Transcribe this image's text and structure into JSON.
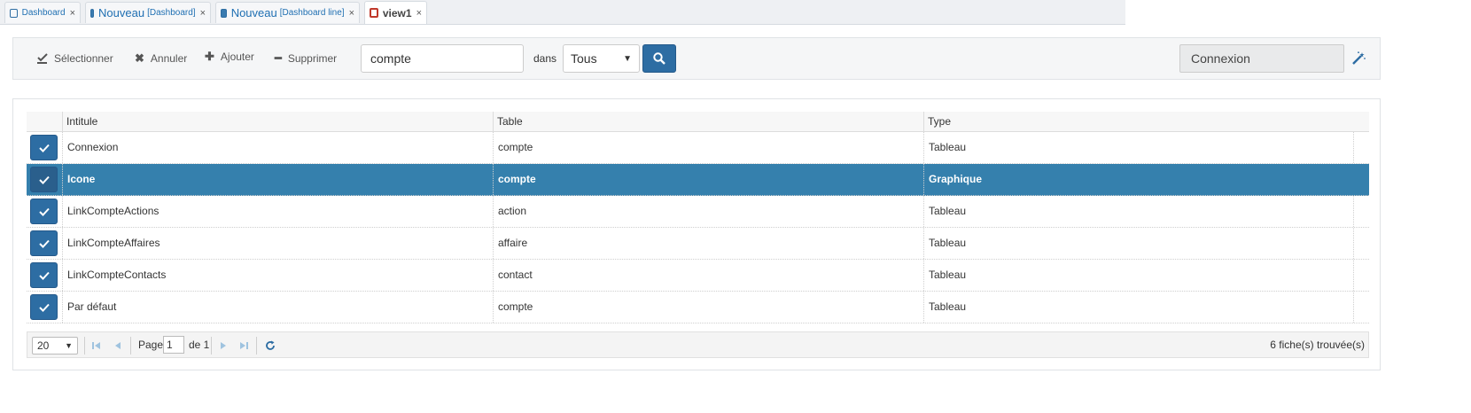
{
  "tabs": [
    {
      "label": "Dashboard",
      "sub": "",
      "close": "×"
    },
    {
      "label": "Nouveau",
      "sub": "[Dashboard]",
      "close": "×"
    },
    {
      "label": "Nouveau",
      "sub": "[Dashboard line]",
      "close": "×"
    },
    {
      "label": "view1",
      "sub": "",
      "close": "×"
    }
  ],
  "toolbar": {
    "select_label": "Sélectionner",
    "cancel_label": "Annuler",
    "add_label": "Ajouter",
    "delete_label": "Supprimer",
    "search_value": "compte",
    "in_label": "dans",
    "scope_value": "Tous",
    "view_value": "Connexion"
  },
  "grid": {
    "columns": [
      "Intitule",
      "Table",
      "Type"
    ],
    "rows": [
      {
        "intitule": "Connexion",
        "table": "compte",
        "type": "Tableau",
        "selected": false
      },
      {
        "intitule": "Icone",
        "table": "compte",
        "type": "Graphique",
        "selected": true
      },
      {
        "intitule": "LinkCompteActions",
        "table": "action",
        "type": "Tableau",
        "selected": false
      },
      {
        "intitule": "LinkCompteAffaires",
        "table": "affaire",
        "type": "Tableau",
        "selected": false
      },
      {
        "intitule": "LinkCompteContacts",
        "table": "contact",
        "type": "Tableau",
        "selected": false
      },
      {
        "intitule": "Par défaut",
        "table": "compte",
        "type": "Tableau",
        "selected": false
      }
    ]
  },
  "pager": {
    "page_size": "20",
    "page_label": "Page",
    "page_value": "1",
    "of_label": "de 1",
    "count_text": "6 fiche(s) trouvée(s)"
  },
  "colors": {
    "accent": "#2d6da3",
    "selected_row": "#3580ad",
    "link": "#1f6fb2"
  }
}
